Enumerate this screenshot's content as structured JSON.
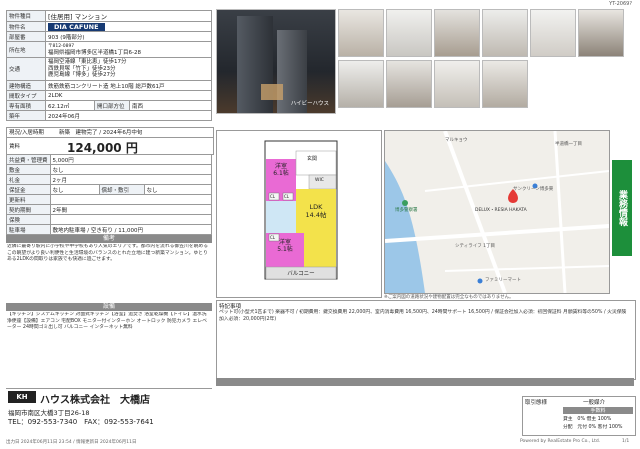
{
  "header": {
    "id": "YT-2069?"
  },
  "spec": {
    "type_label": "物件種目",
    "type_value": "[住居用] マンション",
    "name_label": "物件名",
    "name_value": "DIA CAFUNE",
    "room_label": "部屋番",
    "room_value": "903 (9階部分)",
    "address_label": "所在地",
    "postal": "〒812-0897",
    "address_value": "福岡県福岡市博多区半道橋1丁目6-28",
    "access_label": "交通",
    "access_lines": [
      "福岡空港線「東比恵」徒歩17分",
      "西鉄貝塚「竹下」徒歩23分",
      "鹿児島線「博多」徒歩27分"
    ],
    "structure_label": "建物構造",
    "structure_value": "鉄筋鉄筋コンクリート造 地上10階 総戸数61戸",
    "layout_label": "間取タイプ",
    "layout_value": "2LDK",
    "area_label": "専有面積",
    "area_value": "62.12㎡",
    "dir_label": "開口部方位",
    "dir_value": "南西",
    "built_label": "築年",
    "built_value": "2024年06月",
    "move_label": "現況/入居時期",
    "move_value": "新築　建物完了 / 2024年6月中旬",
    "rent_label": "賃料",
    "rent_value": "124,000 円",
    "mgmt_label": "共益費・管理費",
    "mgmt_value": "5,000円",
    "deposit_label": "敷金",
    "deposit_value": "なし",
    "keymoney_label": "礼金",
    "keymoney_value": "2ヶ月",
    "guarantee_label": "保証金",
    "guarantee_value": "なし",
    "amort_label": "償却・敷引",
    "amort_value": "なし",
    "renewal_label": "更新料",
    "renewal_value": "",
    "contract_label": "契約期間",
    "contract_value": "2年間",
    "insurance_label": "保険",
    "insurance_value": "",
    "parking_label": "駐車場",
    "parking_value": "敷地内駐車場 / 空き有り / 11,000円"
  },
  "notes_title": "備考",
  "notes_text": "近隣に最寄り駅内に小学校や中学校もあり人気のエリアです。都市内を流れる御笠川を眺めるこの眺望がより良い利便性と生活環境のバランスのとれた立地に建つ新築マンション。ゆとりある2LDKの間取りは家族でも快適に過ごせます。",
  "equip_title": "設備",
  "equip_text": "【キッチン】システムキッチン 対面式キッチン【浴室】追焚き 浴室乾燥機【トイレ】温水洗浄便座【設備】エアコン 宅配BOX モニター付インターホン オートロック 防犯カメラ エレベーター 24時間ゴミ出し可 バルコニー インターネット無料",
  "photos": {
    "main_caption": "ハイビーハウス"
  },
  "floorplan": {
    "rooms": [
      {
        "label": "洋室\n6.1帖"
      },
      {
        "label": "LDK\n14.4帖"
      },
      {
        "label": "洋室\n5.1帖"
      },
      {
        "label": "バルコニー"
      },
      {
        "label": "玄関"
      },
      {
        "label": "CL"
      },
      {
        "label": "CL"
      },
      {
        "label": "CL"
      },
      {
        "label": "WIC"
      }
    ]
  },
  "map": {
    "labels": [
      "マルキョウ",
      "博多警察署",
      "半道橋一丁目",
      "サンクリーン博多東",
      "DELUX・RESIA HAKATA",
      "シティライフ 1丁目",
      "ファミリーマート"
    ],
    "footer": "※ご案内図の道路状況や建物配置は完全なものではありません。"
  },
  "remarks": {
    "label": "特記事項",
    "text": "ペット可(小型犬1匹まで) 楽器不可 / 初期費用：鍵交換費用 22,000円、室内消毒費用 16,500円、24時間サポート 16,500円 / 保証会社加入必須：初回保証料 月額賃料等の50% / 火災保険加入必須：20,000円(2年)"
  },
  "agent": {
    "company": "ハウス株式会社　大橋店",
    "address": "福岡市南区大橋3丁目26-18",
    "tel": "TEL：092-553-7340　FAX：092-553-7641"
  },
  "transaction": {
    "label": "取引態様",
    "value": "一般媒介",
    "fee_label": "手数料",
    "fee_rows": [
      "貸主　0% 借主 100%",
      "分配　元付 0% 客付 100%"
    ]
  },
  "footer": {
    "left": "出力日 2024年06月11日 23:54 / 情報更新日 2024年06月11日",
    "right": "Powered by RealEstate Pro Co., Ltd.",
    "page": "1/1"
  },
  "side_tab": "業務情報",
  "colors": {
    "accent_green": "#1d8f3b",
    "band_gray": "#8a8a8a",
    "label_bg": "#eef2f6"
  }
}
